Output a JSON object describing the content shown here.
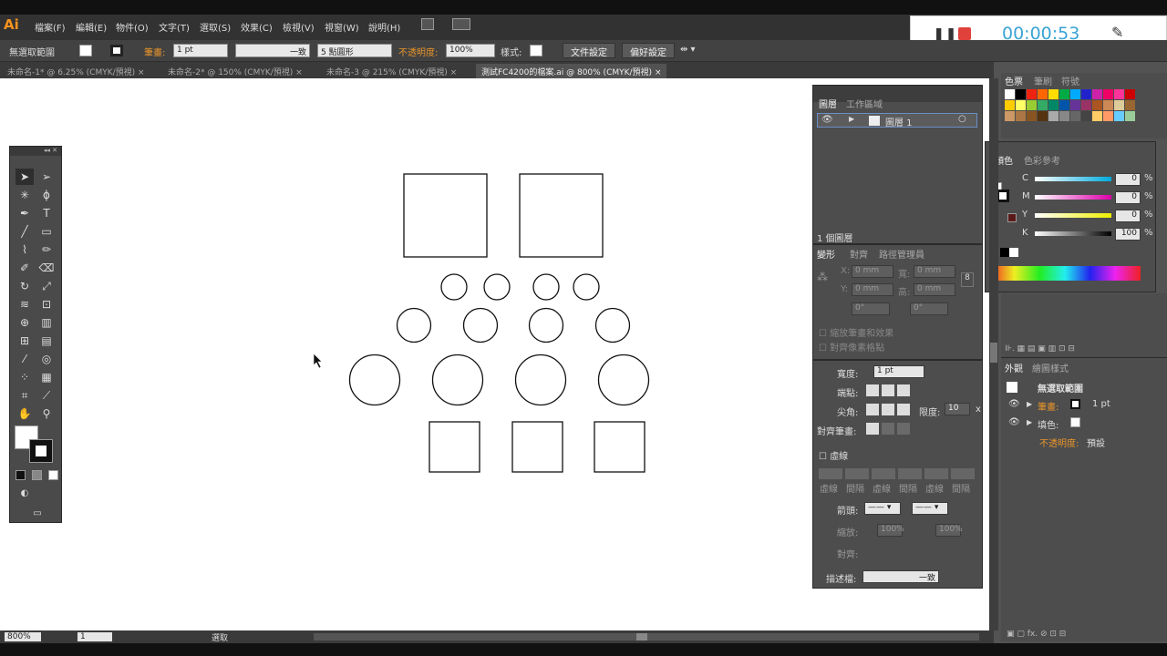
{
  "app": {
    "logo": "Ai"
  },
  "menu": [
    "檔案(F)",
    "編輯(E)",
    "物件(O)",
    "文字(T)",
    "選取(S)",
    "效果(C)",
    "檢視(V)",
    "視窗(W)",
    "說明(H)"
  ],
  "recorder": {
    "timer": "00:00:53",
    "pause_icon": "pause-icon",
    "stop_icon": "stop-icon",
    "pen_icon": "pen-icon",
    "stop_color": "#e0413b",
    "timer_color": "#3aa3d5"
  },
  "control": {
    "selection": "無選取範圍",
    "stroke_label": "筆畫:",
    "stroke_value": "1 pt",
    "line_style": "一致",
    "brush": "5 點圓形",
    "opacity_label": "不透明度:",
    "opacity_value": "100%",
    "style_label": "樣式:",
    "doc_setup": "文件設定",
    "prefs": "偏好設定"
  },
  "tabs": [
    "未命名-1* @ 6.25% (CMYK/預視)",
    "未命名-2* @ 150% (CMYK/預視)",
    "未命名-3 @ 215% (CMYK/預視)",
    "測試FC4200的檔案.ai @ 800% (CMYK/預視)"
  ],
  "layers": {
    "tab_layers": "圖層",
    "tab_artboards": "工作區域",
    "layer_name": "圖層 1",
    "footer": "1 個圖層"
  },
  "transform": {
    "tab_transform": "變形",
    "tab_align": "對齊",
    "tab_pathfinder": "路徑管理員",
    "x_label": "X:",
    "y_label": "Y:",
    "w_label": "寬:",
    "h_label": "高:",
    "x": "0 mm",
    "y": "0 mm",
    "w": "0 mm",
    "h": "0 mm",
    "angle1": "0°",
    "angle2": "0°",
    "check1": "縮放筆畫和效果",
    "check2": "對齊像素格點"
  },
  "stroke": {
    "weight_label": "寬度:",
    "weight": "1 pt",
    "cap_label": "端點:",
    "corner_label": "尖角:",
    "limit_label": "限度:",
    "limit": "10",
    "limit_unit": "x",
    "align_label": "對齊筆畫:",
    "dashed": "虛線",
    "dash_labels": [
      "虛線",
      "間隔",
      "虛線",
      "間隔",
      "虛線",
      "間隔"
    ],
    "arrow_label": "箭頭:",
    "scale_label": "縮放:",
    "scale1": "100%",
    "scale2": "100%",
    "align2_label": "對齊:",
    "profile_label": "描述檔:",
    "profile_value": "一致"
  },
  "swatches": {
    "tab1": "色票",
    "tab2": "筆刷",
    "tab3": "符號"
  },
  "color": {
    "tab1": "顏色",
    "tab2": "色彩參考",
    "channels": [
      {
        "label": "C",
        "value": "0",
        "unit": "%"
      },
      {
        "label": "M",
        "value": "0",
        "unit": "%"
      },
      {
        "label": "Y",
        "value": "0",
        "unit": "%"
      },
      {
        "label": "K",
        "value": "100",
        "unit": "%"
      }
    ]
  },
  "appearance": {
    "tab1": "外觀",
    "tab2": "繪圖樣式",
    "title": "無選取範圍",
    "stroke_label": "筆畫:",
    "stroke_value": "1 pt",
    "fill_label": "填色:",
    "opacity_label": "不透明度:",
    "opacity_value": "預設"
  },
  "status": {
    "zoom": "800%",
    "page": "1",
    "mode": "選取"
  }
}
